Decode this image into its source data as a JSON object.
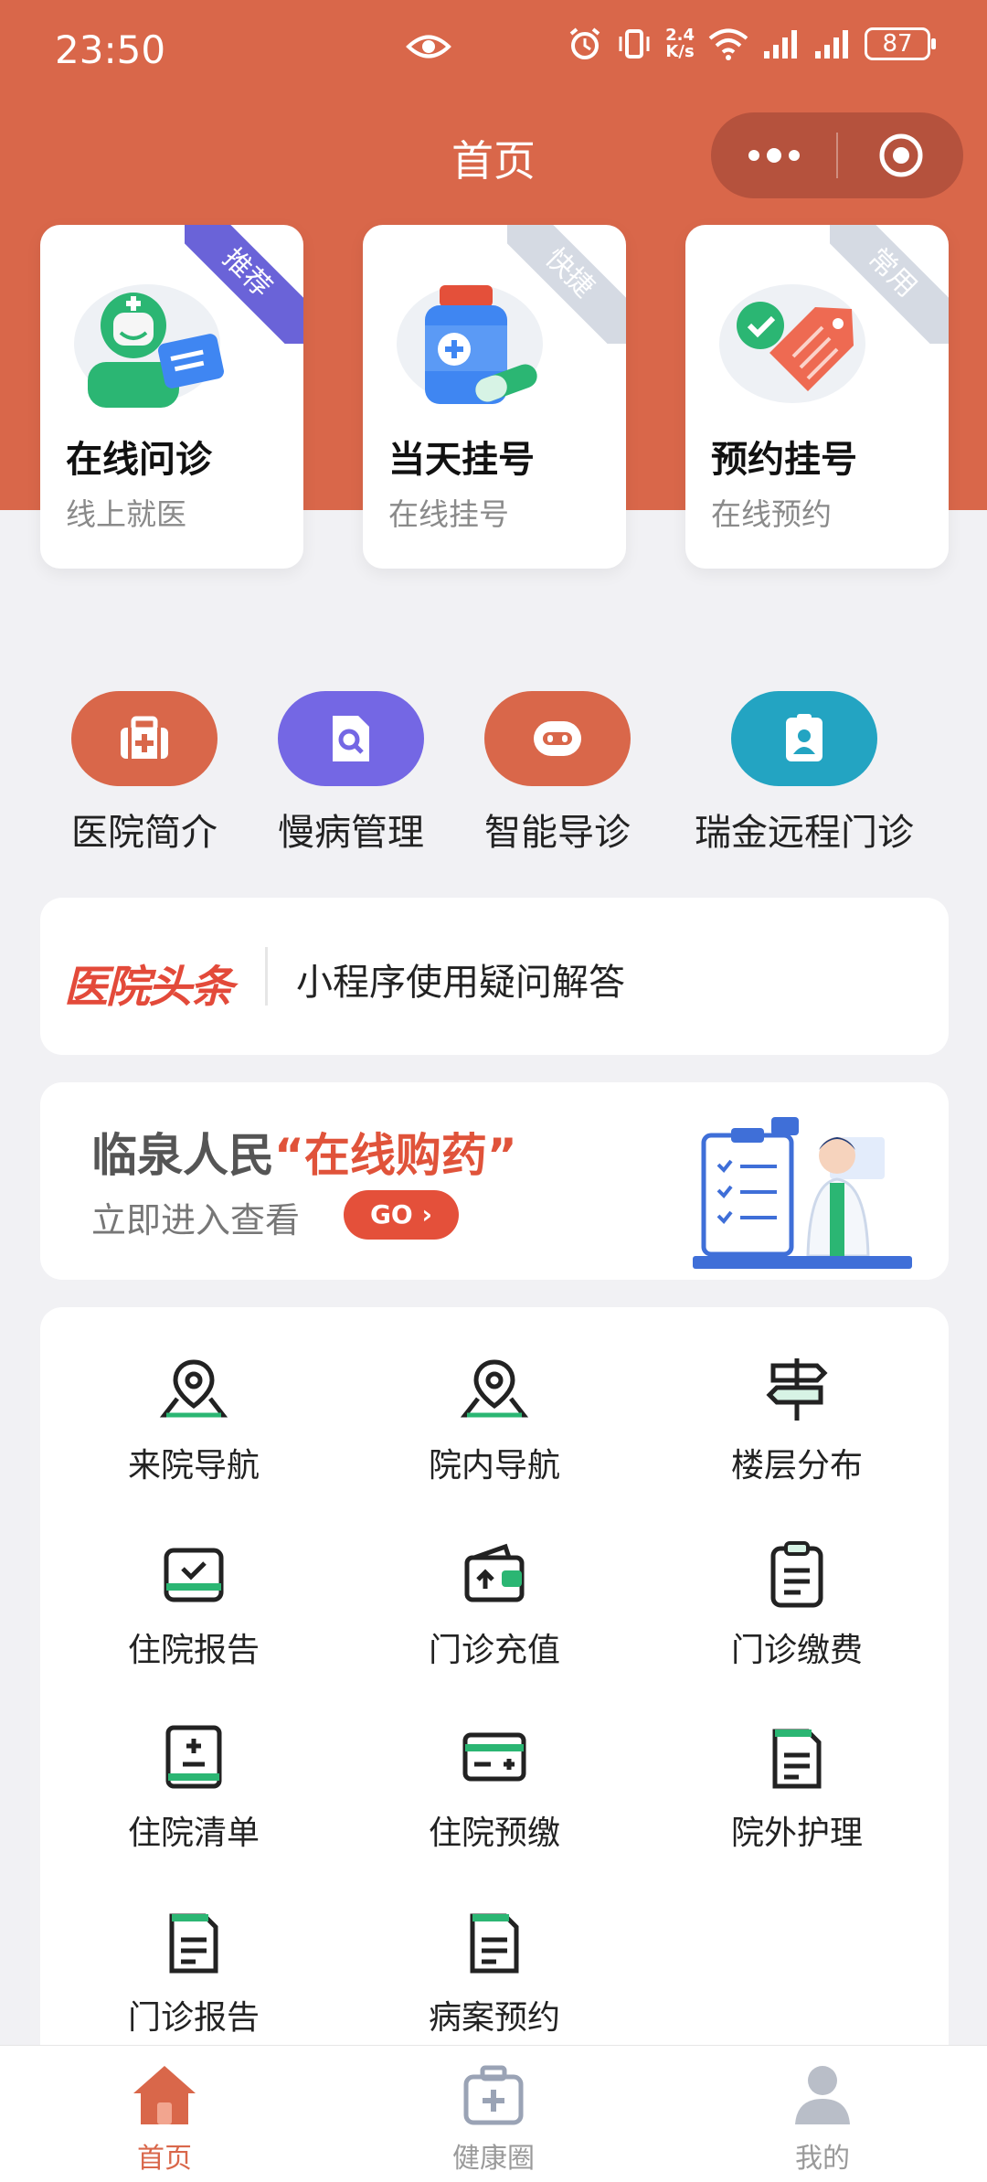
{
  "status_bar": {
    "time": "23:50",
    "net_speed_top": "2.4",
    "net_speed_bottom": "K/s",
    "battery": "87"
  },
  "header": {
    "title": "首页"
  },
  "top_cards": [
    {
      "title": "在线问诊",
      "subtitle": "线上就医",
      "badge": "推荐",
      "badge_color": "#6a63d8"
    },
    {
      "title": "当天挂号",
      "subtitle": "在线挂号",
      "badge": "快捷",
      "badge_color": "#d5dae3"
    },
    {
      "title": "预约挂号",
      "subtitle": "在线预约",
      "badge": "常用",
      "badge_color": "#d5dae3"
    }
  ],
  "quick_actions": [
    {
      "label": "医院简介",
      "icon": "hospital-icon",
      "color": "#d9674a"
    },
    {
      "label": "慢病管理",
      "icon": "document-search-icon",
      "color": "#7467e4"
    },
    {
      "label": "智能导诊",
      "icon": "robot-icon",
      "color": "#d9674a"
    },
    {
      "label": "瑞金远程门诊",
      "icon": "id-badge-icon",
      "color": "#23a4c2"
    }
  ],
  "news": {
    "logo": "医院头条",
    "text": "小程序使用疑问解答"
  },
  "banner": {
    "title_prefix": "临泉人民",
    "title_highlight": "“在线购药”",
    "subtitle": "立即进入查看",
    "go_label": "GO ›"
  },
  "services": [
    {
      "label": "来院导航",
      "icon": "map-pin-icon"
    },
    {
      "label": "院内导航",
      "icon": "map-pin-icon"
    },
    {
      "label": "楼层分布",
      "icon": "signpost-icon"
    },
    {
      "label": "住院报告",
      "icon": "inbox-check-icon"
    },
    {
      "label": "门诊充值",
      "icon": "wallet-icon"
    },
    {
      "label": "门诊缴费",
      "icon": "clipboard-icon"
    },
    {
      "label": "住院清单",
      "icon": "calculator-icon"
    },
    {
      "label": "住院预缴",
      "icon": "card-icon"
    },
    {
      "label": "院外护理",
      "icon": "document-icon"
    },
    {
      "label": "门诊报告",
      "icon": "document-icon"
    },
    {
      "label": "病案预约",
      "icon": "document-icon"
    }
  ],
  "tabs": [
    {
      "label": "首页",
      "icon": "home-icon",
      "active": true
    },
    {
      "label": "健康圈",
      "icon": "medical-kit-icon",
      "active": false
    },
    {
      "label": "我的",
      "icon": "user-icon",
      "active": false
    }
  ],
  "colors": {
    "brand": "#d9674a",
    "accent_green": "#2bb673",
    "background": "#f1f1f4"
  }
}
